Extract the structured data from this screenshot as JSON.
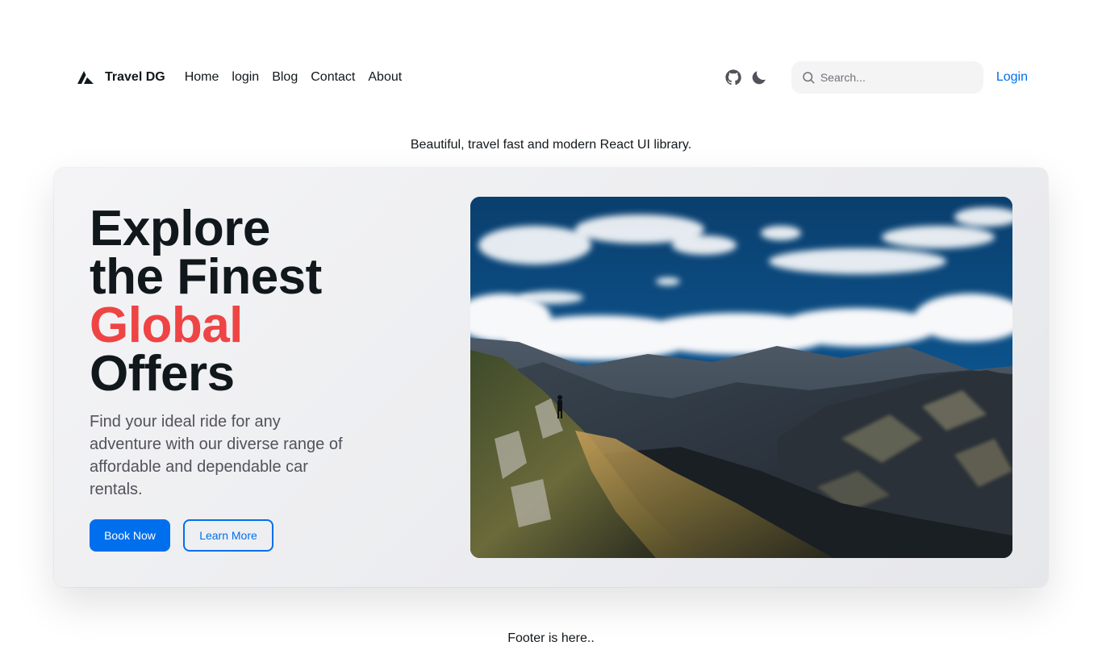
{
  "brand": {
    "name": "Travel DG",
    "logo_icon": "acme-logo-icon"
  },
  "nav": {
    "links": [
      "Home",
      "login",
      "Blog",
      "Contact",
      "About"
    ]
  },
  "header_actions": {
    "github_icon": "github-icon",
    "theme_icon": "moon-icon",
    "search_placeholder": "Search...",
    "search_icon": "search-icon",
    "login_label": "Login"
  },
  "tagline": "Beautiful, travel fast and modern React UI library.",
  "hero": {
    "title_lines": [
      "Explore",
      "the Finest",
      "Global",
      "Offers"
    ],
    "description": "Find your ideal ride for any adventure with our diverse range of affordable and dependable car rentals.",
    "primary_button": "Book Now",
    "secondary_button": "Learn More",
    "image_subject": "mountain-landscape"
  },
  "footer": {
    "text": "Footer is here.."
  },
  "colors": {
    "primary": "#006fee",
    "accent": "#ef4444",
    "text": "#11181c",
    "muted": "#52525b",
    "search_bg": "#f4f4f5"
  }
}
